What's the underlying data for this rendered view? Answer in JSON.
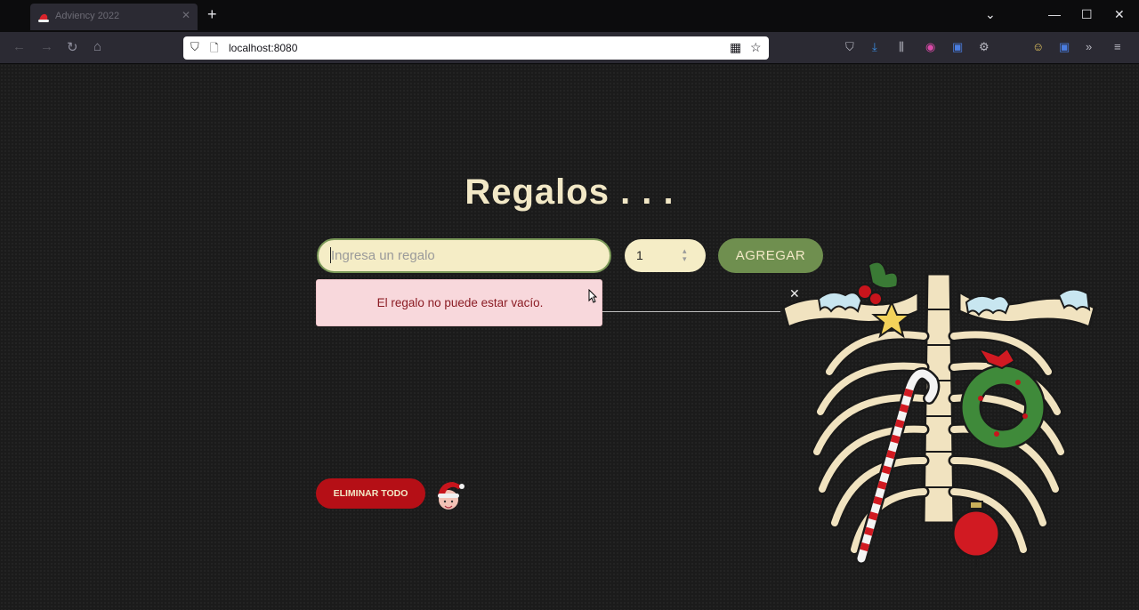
{
  "browser": {
    "tab_title": "Adviency 2022",
    "url": "localhost:8080"
  },
  "page": {
    "title": "Regalos . . .",
    "gift_input": {
      "placeholder": "Ingresa un regalo",
      "value": ""
    },
    "quantity": {
      "value": "1"
    },
    "add_button_label": "AGREGAR",
    "error_message": "El regalo no puede estar vacío.",
    "delete_all_label": "ELIMINAR TODO"
  },
  "colors": {
    "accent_green": "#6f8f4f",
    "cream": "#f2e8c6",
    "danger_red": "#b50f16",
    "error_bg": "#f8d8dc",
    "error_text": "#8b1c24"
  },
  "icons": {
    "close": "close-icon",
    "santa": "santa-hat-icon",
    "decoration": "christmas-skeleton-illustration"
  }
}
